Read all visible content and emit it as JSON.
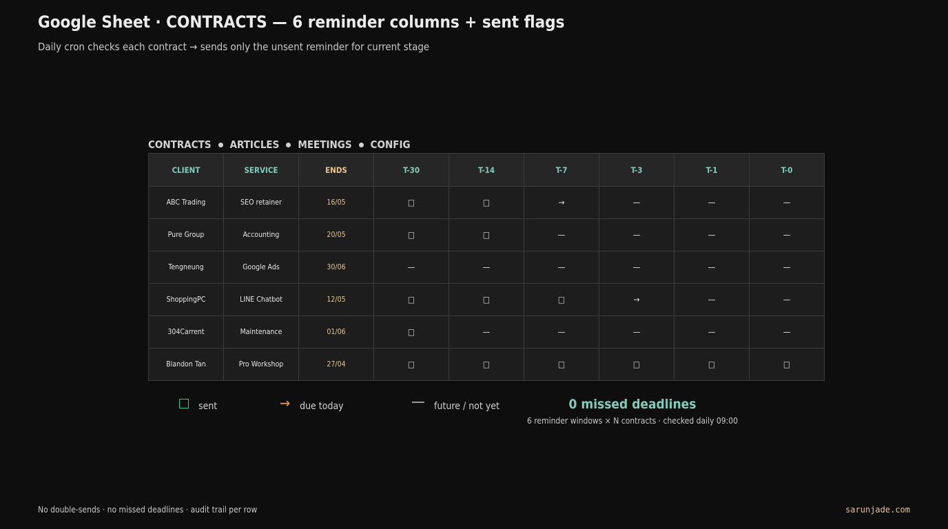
{
  "header": {
    "title": "Google Sheet · CONTRACTS — 6 reminder columns + sent flags",
    "subtitle": "Daily cron checks each contract → sends only the unsent reminder for current stage"
  },
  "tabs": [
    "CONTRACTS",
    "ARTICLES",
    "MEETINGS",
    "CONFIG"
  ],
  "table": {
    "columns": [
      "CLIENT",
      "SERVICE",
      "ENDS",
      "T-30",
      "T-14",
      "T-7",
      "T-3",
      "T-1",
      "T-0"
    ],
    "rows": [
      [
        "ABC Trading",
        "SEO retainer",
        "16/05",
        "□",
        "□",
        "→",
        "—",
        "—",
        "—"
      ],
      [
        "Pure Group",
        "Accounting",
        "20/05",
        "□",
        "□",
        "—",
        "—",
        "—",
        "—"
      ],
      [
        "Tengneung",
        "Google Ads",
        "30/06",
        "—",
        "—",
        "—",
        "—",
        "—",
        "—"
      ],
      [
        "ShoppingPC",
        "LINE Chatbot",
        "12/05",
        "□",
        "□",
        "□",
        "→",
        "—",
        "—"
      ],
      [
        "304Carrent",
        "Maintenance",
        "01/06",
        "□",
        "—",
        "—",
        "—",
        "—",
        "—"
      ],
      [
        "Blandon Tan",
        "Pro Workshop",
        "27/04",
        "□",
        "□",
        "□",
        "□",
        "□",
        "□"
      ]
    ]
  },
  "legend": {
    "sent": "sent",
    "due": "due today",
    "future": "future / not yet",
    "due_symbol": "→"
  },
  "summary": {
    "headline": "0 missed deadlines",
    "detail": "6 reminder windows × N contracts · checked daily 09:00"
  },
  "footer": {
    "left": "No double-sends · no missed deadlines · audit trail per row",
    "right": "sarunjade.com"
  },
  "colors": {
    "accent_teal": "#7fcdbb",
    "accent_gold": "#e8c38f",
    "sent_green": "#2ecc8a",
    "due_orange": "#f0a030"
  }
}
